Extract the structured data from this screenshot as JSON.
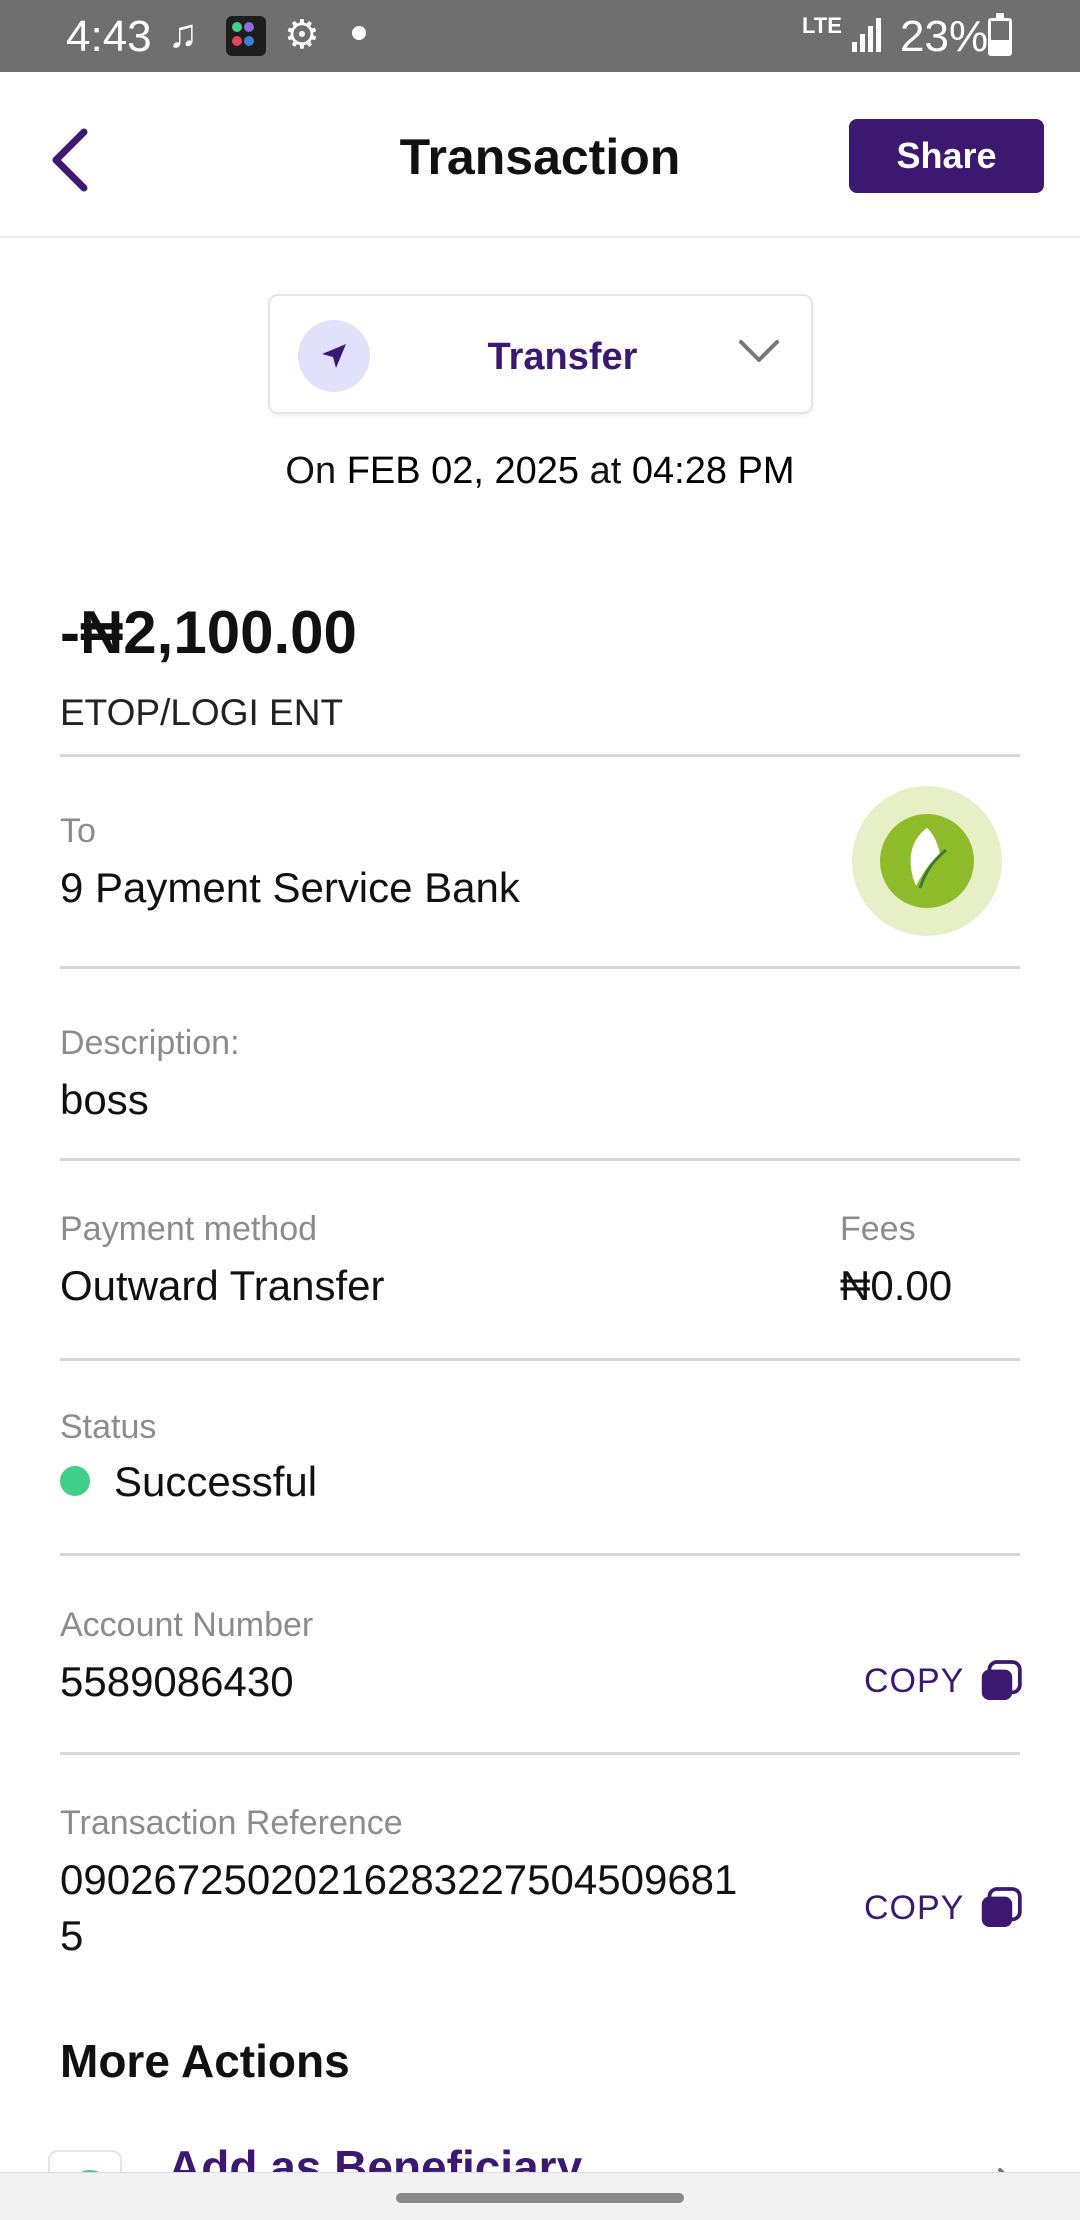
{
  "status_bar": {
    "time": "4:43",
    "network": "LTE",
    "battery": "23%"
  },
  "header": {
    "title": "Transaction",
    "share_label": "Share"
  },
  "type_selector": {
    "label": "Transfer"
  },
  "datetime": {
    "prefix": "On",
    "date": "FEB 02, 2025",
    "at": "at",
    "time": "04:28 PM"
  },
  "transaction": {
    "amount": "-₦2,100.00",
    "payee": "ETOP/LOGI ENT",
    "to_label": "To",
    "to_value": "9 Payment Service Bank",
    "description_label": "Description:",
    "description_value": "boss",
    "payment_method_label": "Payment method",
    "payment_method_value": "Outward Transfer",
    "fees_label": "Fees",
    "fees_value": "₦0.00",
    "status_label": "Status",
    "status_value": "Successful",
    "account_number_label": "Account Number",
    "account_number_value": "5589086430",
    "reference_label": "Transaction Reference",
    "reference_line1": "09026725020216283227504509681",
    "reference_line2": "5",
    "copy_label": "COPY"
  },
  "more_actions": {
    "title": "More Actions",
    "add_beneficiary": "Add as Beneficiary"
  },
  "colors": {
    "brand": "#3d1870",
    "status_success": "#3fcf89",
    "bank_logo": "#8dbb2a"
  },
  "icons": [
    "back-icon",
    "send-icon",
    "chevron-down-icon",
    "bank-logo",
    "copy-icon",
    "chevron-right-icon"
  ]
}
